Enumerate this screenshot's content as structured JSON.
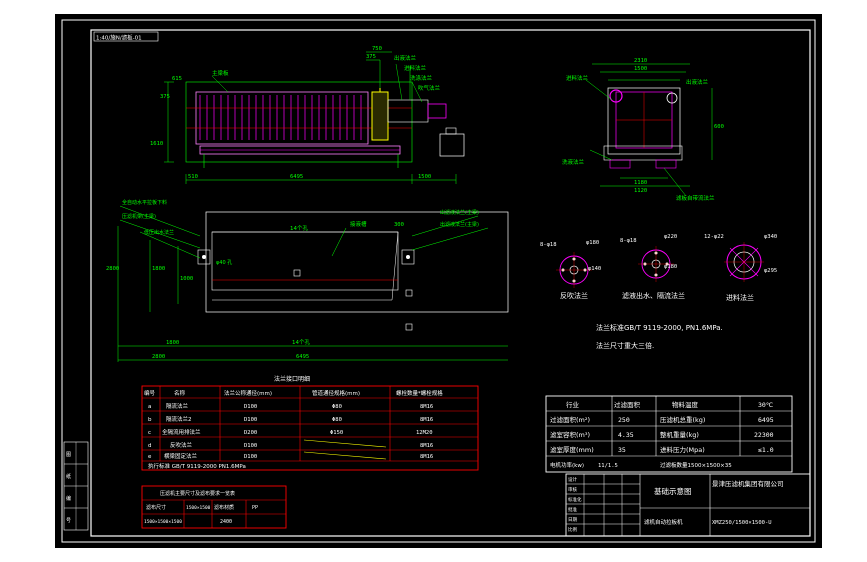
{
  "title_block_tag": "1:40/施N/滤板-01",
  "colors": {
    "paper": "#ffffff",
    "sheet": "#000000",
    "frame": "#ffffff",
    "dim": "#00ff00",
    "label": "#00ff00",
    "machine": "#ff00ff",
    "motor": "#ffff00",
    "table": "#ff0000",
    "accent": "#ff8080",
    "red": "#ff0000"
  },
  "front_view": {
    "labels": {
      "plate": "主梁板",
      "outlet": "出液法兰",
      "inlet": "进料法兰",
      "wash": "洗涤法兰",
      "air": "吹气法兰"
    },
    "dims": {
      "d750": "750",
      "d375": "375",
      "d1500": "1500",
      "d6495": "6495",
      "d510": "510",
      "d1610": "1610",
      "d615": "615",
      "d375b": "375"
    }
  },
  "side_view": {
    "labels": {
      "inlet": "进料法兰",
      "outlet": "出液法兰",
      "water": "洗液法兰",
      "drain": "滤板自带流法兰"
    },
    "dims": {
      "d2310": "2310",
      "d1500": "1500",
      "d1180": "1180",
      "d1120": "1120",
      "d600": "600"
    }
  },
  "plan_view": {
    "labels": {
      "tl1": "全自动水平拉板下料",
      "tl2": "压滤机架(主梁)",
      "tl3": "低压出水法兰",
      "tr1": "出滤液法兰(主梁)",
      "tr2": "出滤液法兰(主梁)",
      "pit": "接液槽",
      "mid1": "14个孔",
      "mid2": "14个孔",
      "cyl": "φ40 孔"
    },
    "dims": {
      "d1800": "1800",
      "d6495": "6495",
      "d2800": "2800",
      "d300": "300",
      "d1000": "1000",
      "d1800v": "1800",
      "d2800v": "2800"
    }
  },
  "flanges": [
    {
      "spec": "8-φ18",
      "d1": "φ180",
      "d2": "φ140",
      "name": "反吹法兰"
    },
    {
      "spec": "8-φ18",
      "d1": "φ220",
      "d2": "φ180",
      "name": "滤液出水、隔流法兰"
    },
    {
      "spec": "12-φ22",
      "d1": "φ340",
      "d2": "φ295",
      "name": "进料法兰"
    }
  ],
  "flange_notes": [
    "法兰标准GB/T 9119-2000, PN1.6MPa.",
    "法兰尺寸重大三倍."
  ],
  "main_table": {
    "title": "法兰接口明细",
    "headers": [
      "编号",
      "名称",
      "法兰公称通径(mm)",
      "管道通径规格(mm)",
      "螺栓数量*螺栓规格"
    ],
    "rows": [
      [
        "a",
        "隔流法兰",
        "D100",
        "Φ80",
        "8M16"
      ],
      [
        "b",
        "隔流法兰2",
        "D100",
        "Φ80",
        "8M16"
      ],
      [
        "c",
        "全隔流用排法兰",
        "D200",
        "Φ150",
        "12M20"
      ],
      [
        "d",
        "反吹法兰",
        "D100",
        "",
        "8M16"
      ],
      [
        "e",
        "横梁固定法兰",
        "D100",
        "",
        "8M16"
      ]
    ],
    "footer": "执行标准  GB/T 9119-2000  PN1.6MPa"
  },
  "sub_table": {
    "title": "压滤机主要尺寸及滤布要求一览表",
    "rows": [
      [
        "滤布尺寸",
        "1500×1500",
        "滤布材质",
        "PP"
      ],
      [
        "1500×1500×1500",
        "",
        "2400",
        ""
      ]
    ]
  },
  "spec_table": {
    "rows": [
      [
        "行业",
        "过滤面积",
        "物料温度",
        "30℃"
      ],
      [
        "过滤面积(m²)",
        "250",
        "压滤机总重(kg)",
        "6495"
      ],
      [
        "滤室容积(m³)",
        "4.35",
        "整机重量(kg)",
        "22300"
      ],
      [
        "滤室厚度(mm)",
        "35",
        "进料压力(Mpa)",
        "≤1.0"
      ],
      [
        "电机功率(kw)",
        "11/1.5",
        "过滤板数量1500×1500×35",
        ""
      ]
    ]
  },
  "title_block": {
    "drawing_name": "基础示意图",
    "company": "景津压滤机集团有限公司",
    "model": "XMZ250/1500×1500-U",
    "left_labels": [
      "设计",
      "审核",
      "标准化",
      "批准",
      "日期",
      "比例"
    ],
    "note": "滤机自动拉板机"
  },
  "side_stamp": [
    "图",
    "纸",
    "编",
    "号"
  ]
}
